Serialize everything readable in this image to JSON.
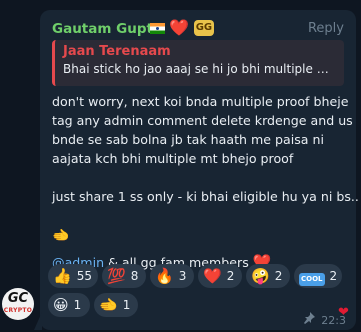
{
  "message": {
    "sender": "Gautam Gupta",
    "badges": {
      "heart": "❤️",
      "gg": "GG"
    },
    "reply_label": "Reply",
    "quote": {
      "author": "Jaan Terenaam",
      "text": "Bhai stick ho jao aaaj se hi jo bhi multiple pr..."
    },
    "body_lines": [
      "don't worry, next koi bnda multiple proof bheje",
      "tag any admin comment delete krdenge and us",
      "bnde se sab bolna jb tak haath me paisa ni",
      "aajata kch bhi multiple mt bhejo proof"
    ],
    "body_line_2": "just share 1 ss only  - ki bhai eligible hu ya ni bs..",
    "hand_emoji": "🫲",
    "mention": "@admin",
    "mention_suffix": " & all gg fam members ",
    "mention_heart": "❤️",
    "time": "22:3",
    "pin_icon": "pushpin-icon"
  },
  "reactions": [
    {
      "emoji": "👍",
      "count": "55"
    },
    {
      "emoji": "💯",
      "count": "8"
    },
    {
      "emoji": "🔥",
      "count": "3"
    },
    {
      "emoji": "❤️",
      "count": "2"
    },
    {
      "emoji": "🤪",
      "count": "2"
    },
    {
      "emoji": "COOL",
      "count": "2"
    },
    {
      "emoji": "😀",
      "count": "1"
    },
    {
      "emoji": "🫲",
      "count": "1"
    }
  ],
  "avatar": {
    "initials": "GC",
    "subtitle": "CRYPTO"
  },
  "colors": {
    "background": "#0e1621",
    "bubble": "#182533",
    "sender": "#6fcf6a",
    "quote_accent": "#e5494d",
    "link": "#6ab2f2",
    "reaction_pill": "#2b3a4a"
  }
}
